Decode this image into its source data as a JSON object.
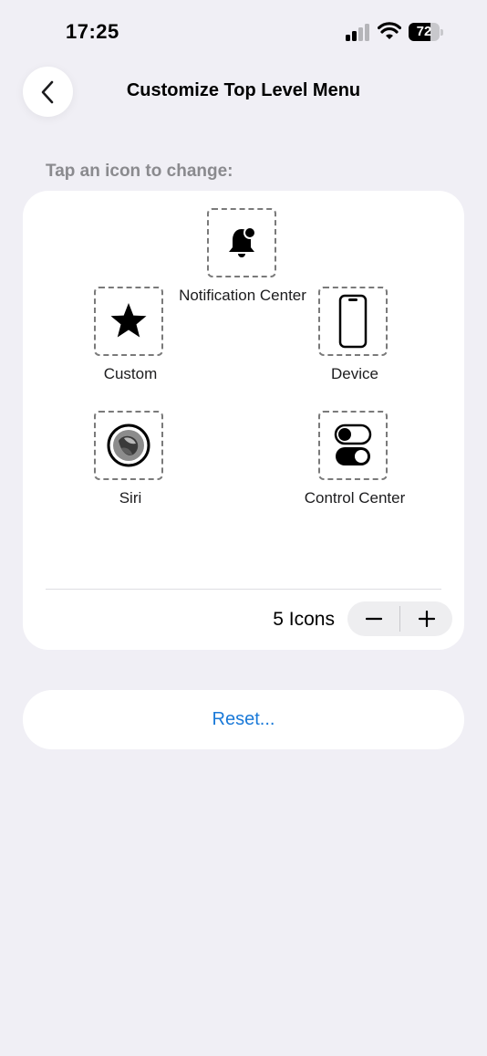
{
  "status_bar": {
    "time": "17:25",
    "battery_percent": "72",
    "icons": [
      "cellular-signal-icon",
      "wifi-icon",
      "battery-icon"
    ]
  },
  "header": {
    "title": "Customize Top Level Menu",
    "back_icon": "chevron-left-icon"
  },
  "section_header": "Tap an icon to change:",
  "menu_slots": [
    {
      "label": "Notification Center",
      "icon": "notification-bell-icon"
    },
    {
      "label": "Custom",
      "icon": "star-icon"
    },
    {
      "label": "Device",
      "icon": "device-phone-icon"
    },
    {
      "label": "Siri",
      "icon": "siri-icon"
    },
    {
      "label": "Control Center",
      "icon": "control-center-toggles-icon"
    }
  ],
  "icon_count": {
    "label": "5 Icons",
    "minus_icon": "minus-icon",
    "plus_icon": "plus-icon"
  },
  "reset": {
    "label": "Reset..."
  },
  "colors": {
    "background": "#f0eff5",
    "card": "#ffffff",
    "accent_link": "#1a79d8",
    "secondary_text": "#8a8a8e"
  }
}
